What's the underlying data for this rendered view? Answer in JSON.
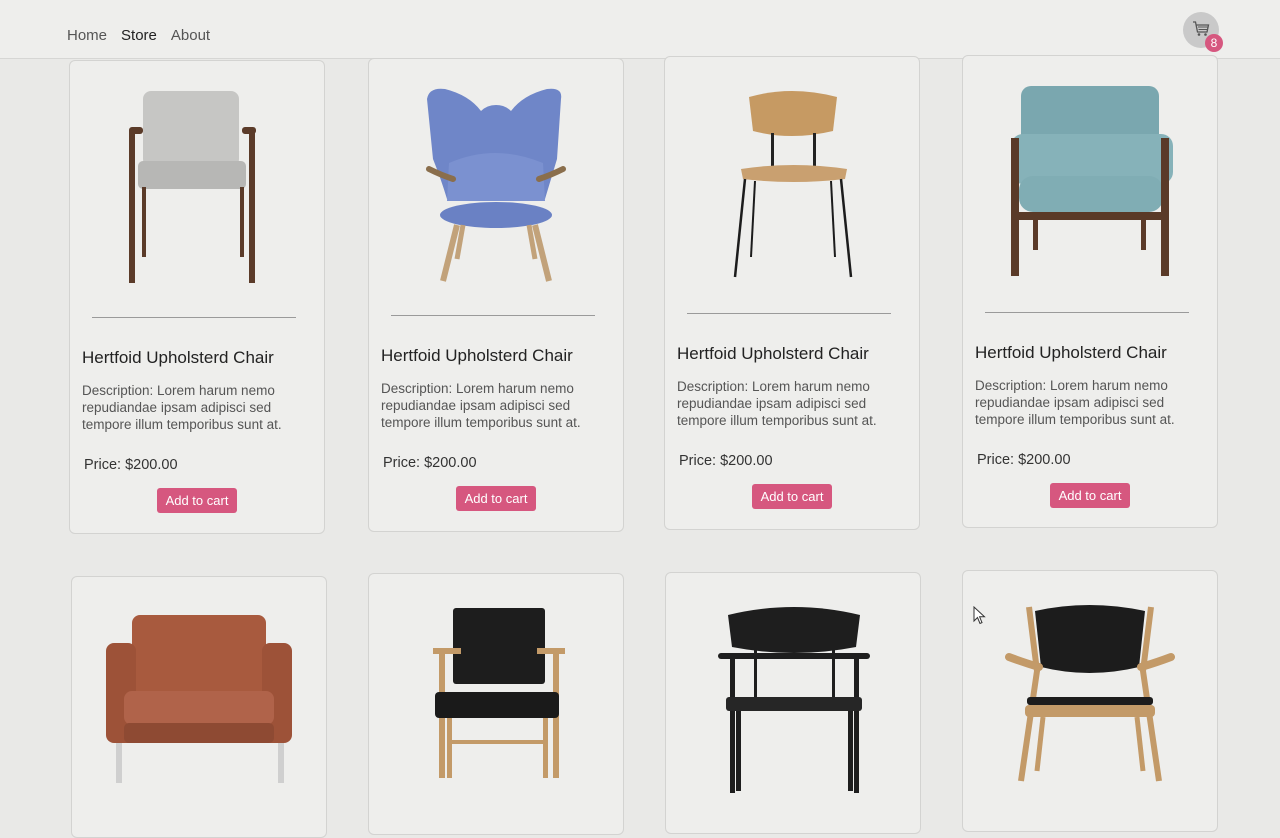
{
  "nav": {
    "links": [
      "Home",
      "Store",
      "About"
    ],
    "cart_count": "8"
  },
  "products": [
    {
      "title": "Hertfoid Upholsterd Chair",
      "description": "Description: Lorem harum nemo repudiandae ipsam adipisci sed tempore illum temporibus sunt at.",
      "price": "Price: $200.00",
      "button": "Add to cart"
    },
    {
      "title": "Hertfoid Upholsterd Chair",
      "description": "Description: Lorem harum nemo repudiandae ipsam adipisci sed tempore illum temporibus sunt at.",
      "price": "Price: $200.00",
      "button": "Add to cart"
    },
    {
      "title": "Hertfoid Upholsterd Chair",
      "description": "Description: Lorem harum nemo repudiandae ipsam adipisci sed tempore illum temporibus sunt at.",
      "price": "Price: $200.00",
      "button": "Add to cart"
    },
    {
      "title": "Hertfoid Upholsterd Chair",
      "description": "Description: Lorem harum nemo repudiandae ipsam adipisci sed tempore illum temporibus sunt at.",
      "price": "Price: $200.00",
      "button": "Add to cart"
    }
  ],
  "theme": {
    "accent": "#d6577f",
    "background": "#e9e9e7",
    "card": "#eeeeec"
  }
}
